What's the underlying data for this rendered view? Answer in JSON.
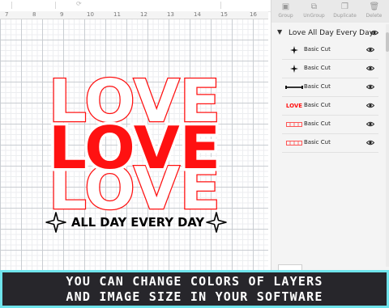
{
  "toolbar": {
    "tools": [
      {
        "label": "Group",
        "icon": "group-icon"
      },
      {
        "label": "UnGroup",
        "icon": "ungroup-icon"
      },
      {
        "label": "Duplicate",
        "icon": "duplicate-icon"
      },
      {
        "label": "Delete",
        "icon": "trash-icon"
      }
    ]
  },
  "ruler": {
    "numbers": [
      "7",
      "8",
      "9",
      "10",
      "11",
      "12",
      "13",
      "14",
      "15",
      "16"
    ]
  },
  "artwork": {
    "word_top": "LOVE",
    "word_middle": "LOVE",
    "word_bottom": "LOVE",
    "tagline": "ALL DAY EVERY DAY",
    "colors": {
      "red": "#ff1111",
      "black": "#000000"
    }
  },
  "layers": {
    "group_title": "Love All Day Every Day",
    "items": [
      {
        "label": "Basic Cut",
        "thumb": "sparkle-icon"
      },
      {
        "label": "Basic Cut",
        "thumb": "sparkle-icon"
      },
      {
        "label": "Basic Cut",
        "thumb": "tagline-thumb"
      },
      {
        "label": "Basic Cut",
        "thumb": "love-solid-thumb",
        "thumb_text": "LOVE"
      },
      {
        "label": "Basic Cut",
        "thumb": "love-outline-thumb"
      },
      {
        "label": "Basic Cut",
        "thumb": "love-outline-thumb"
      }
    ]
  },
  "banner": {
    "line1": "YOU CAN CHANGE COLORS OF LAYERS",
    "line2": "AND IMAGE SIZE IN YOUR SOFTWARE",
    "border_color": "#6fe4ec",
    "bg_color": "#27262b"
  }
}
